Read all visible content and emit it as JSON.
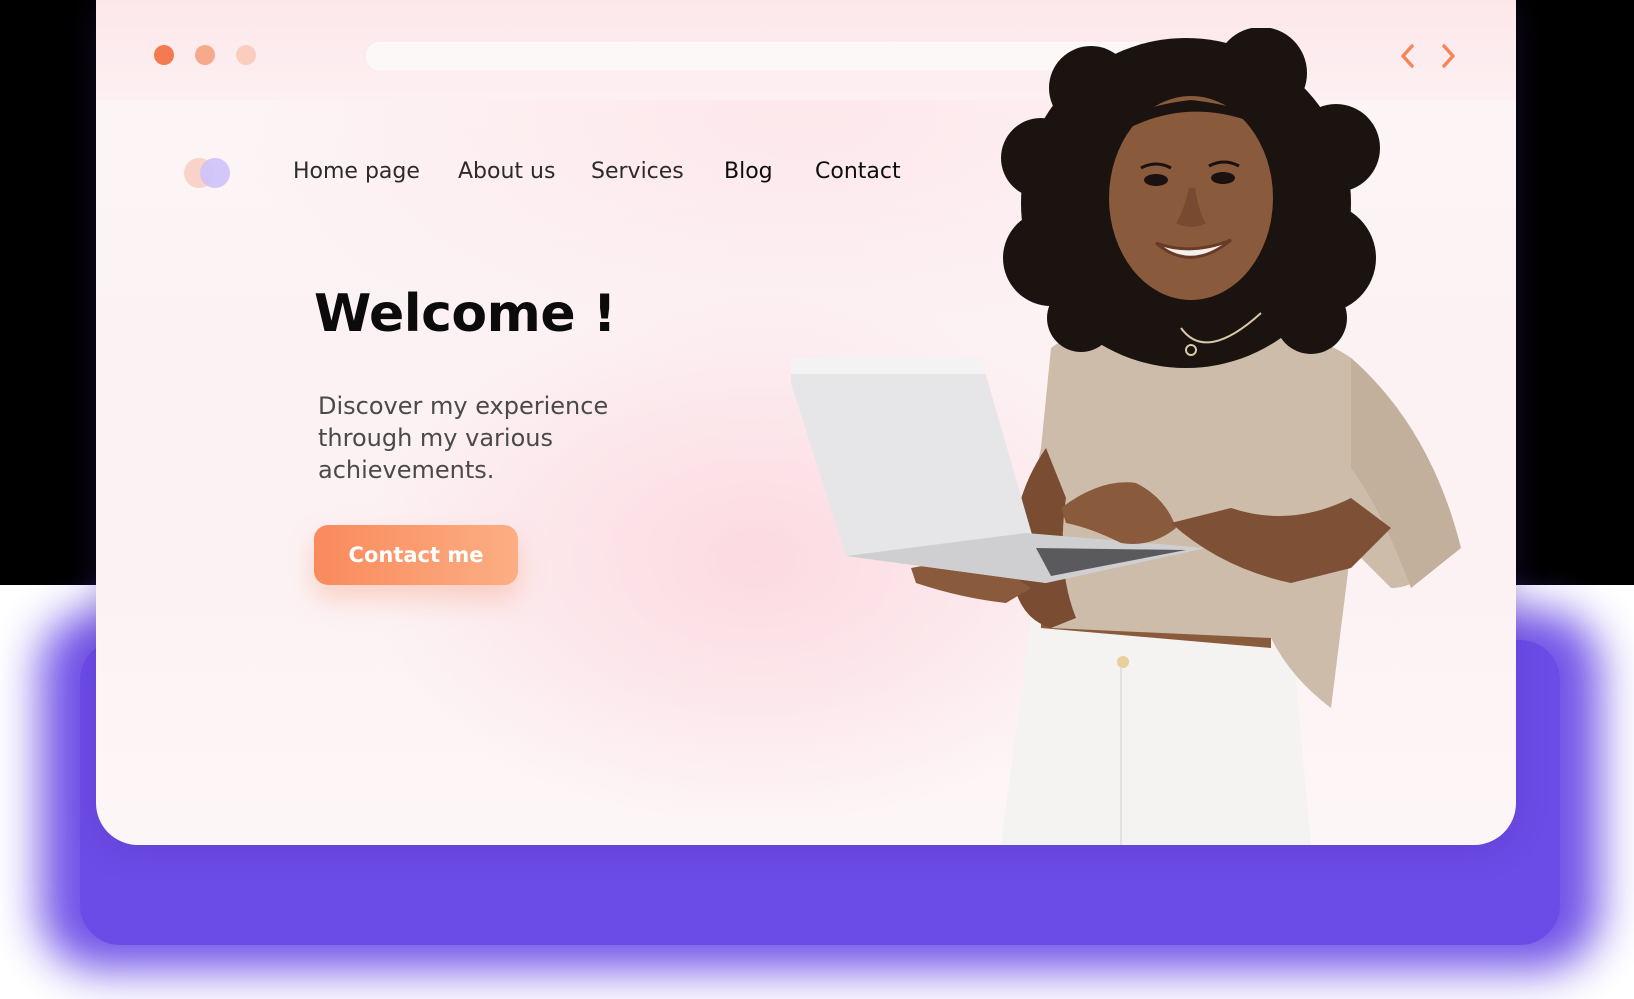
{
  "browser": {
    "window_controls": [
      "close",
      "minimize",
      "maximize"
    ],
    "back_icon": "chevron-left-icon",
    "forward_icon": "chevron-right-icon",
    "accent_color": "#f4875a"
  },
  "nav": {
    "logo": "logo-mark",
    "items": [
      {
        "label": "Home page"
      },
      {
        "label": "About us"
      },
      {
        "label": "Services"
      },
      {
        "label": "Blog"
      },
      {
        "label": "Contact"
      }
    ]
  },
  "hero": {
    "title": "Welcome !",
    "tagline": "Discover my experience through my various achievements.",
    "cta_label": "Contact me",
    "cta_color": "#f98a5c",
    "image": "woman-holding-laptop-photo"
  },
  "colors": {
    "backdrop_purple": "#6b4ce6",
    "page_background": "#fdf3f4"
  }
}
